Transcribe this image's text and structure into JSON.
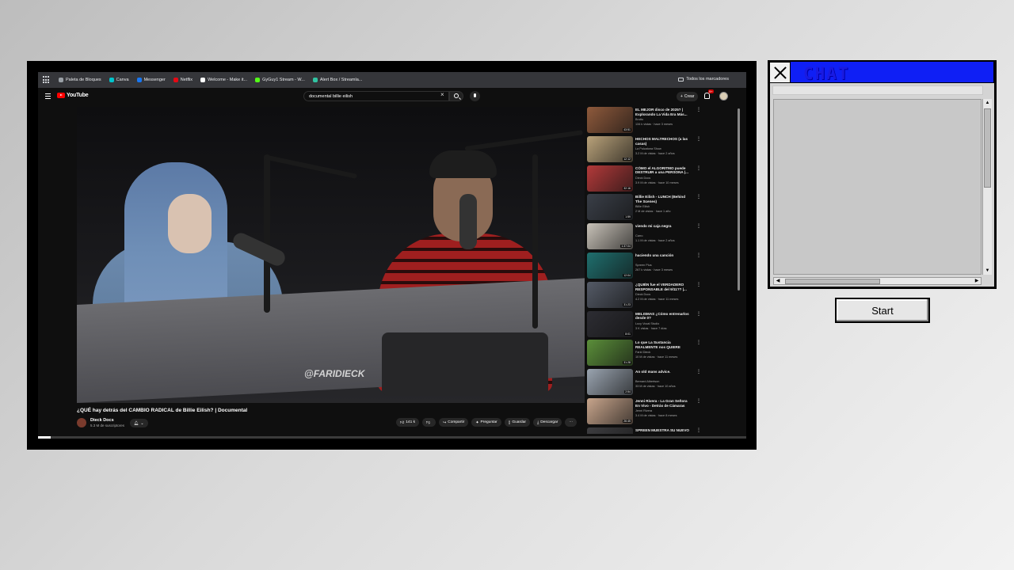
{
  "bookmarks": {
    "items": [
      {
        "label": "Paleta de Bloques",
        "icon": "grid-favicon",
        "color": "#9aa0a6"
      },
      {
        "label": "Canva",
        "icon": "canva-favicon",
        "color": "#00c4cc"
      },
      {
        "label": "Messenger",
        "icon": "messenger-favicon",
        "color": "#1877f2"
      },
      {
        "label": "Netflix",
        "icon": "netflix-favicon",
        "color": "#e50914"
      },
      {
        "label": "Welcome - Make it...",
        "icon": "make-favicon",
        "color": "#ffffff"
      },
      {
        "label": "GyGuy1 Stream - W...",
        "icon": "kick-favicon",
        "color": "#53fc18"
      },
      {
        "label": "Alert Box / Streamla...",
        "icon": "streamlabs-favicon",
        "color": "#31c3a2"
      }
    ],
    "all_label": "Todos los marcadores"
  },
  "youtube": {
    "logo_text": "YouTube",
    "search_value": "documental billie eilish",
    "create_label": "Crear",
    "notifications_count": "9+"
  },
  "video": {
    "watermark": "@FARIDIECK",
    "title": "¿QUÉ hay detrás del CAMBIO RADICAL de Billie Eilish? | Documental",
    "channel": "Dieck Docs",
    "subscribers": "5.3 M de suscriptores",
    "likes": "141 k",
    "actions": {
      "share": "Compartir",
      "ask": "Preguntar",
      "save": "Guardar",
      "download": "Descargar"
    },
    "progress": 0.018
  },
  "recommendations": [
    {
      "title": "EL MEJOR disco de 2025? | Explorando La Vida Era Más...",
      "channel": "Brutto",
      "meta": "134 k vistas · hace 3 meses",
      "duration": "43:51",
      "color": "#8f5a3c"
    },
    {
      "title": "HECHOS MALTRECHOS (a las casas)",
      "channel": "La Pulcatona Show",
      "meta": "3.2 M de vistas · hace 2 años",
      "duration": "12:12",
      "color": "#b9a27a"
    },
    {
      "title": "CÓMO el ALGORITMO puede DESTRUIR a una PERSONA |...",
      "channel": "Dieck Docs",
      "meta": "3.9 M de vistas · hace 10 meses",
      "duration": "32:16",
      "color": "#b33a3a"
    },
    {
      "title": "Billie Eilish - LUNCH (Behind The Scenes)",
      "channel": "Billie Eilish",
      "meta": "2 M de vistas · hace 1 año",
      "duration": "1:59",
      "color": "#3a3f48"
    },
    {
      "title": "viendo mi caja negra",
      "channel": "Carro",
      "meta": "1.1 M de vistas · hace 2 años",
      "duration": "1:37:04",
      "color": "#c8c2b8"
    },
    {
      "title": "haciendo una canción",
      "channel": "Spreen Plus",
      "meta": "267 k vistas · hace 3 meses",
      "duration": "12:04",
      "color": "#1f6f6e"
    },
    {
      "title": "¿QUIÉN fue el VERDADERO RESPONSABLE del 9/11?? |...",
      "channel": "Dieck Docs",
      "meta": "4.2 M de vistas · hace 11 meses",
      "duration": "31:23",
      "color": "#545a66"
    },
    {
      "title": "MELISMAS ¿Cómo entrenarlos desde 0?",
      "channel": "Lucy Vocal Studio",
      "meta": "3 K vistas · hace 7 días",
      "duration": "8:01",
      "color": "#2d2d33"
    },
    {
      "title": "Lo que La Sustancia REALMENTE nos QUIERE DECI...",
      "channel": "Farid Dieck",
      "meta": "10 M de vistas · hace 11 meses",
      "duration": "31:28",
      "color": "#5b8f3a"
    },
    {
      "title": "An old mans advice.",
      "channel": "Bernard Albertson",
      "meta": "33 M de vistas · hace 10 años",
      "duration": "2:54",
      "color": "#9aa4b0"
    },
    {
      "title": "Jenni Rivera - La Gran Señora En Vivo - Detrás de Cámaras",
      "channel": "Jenni Rivera",
      "meta": "3.4 M de vistas · hace 8 meses",
      "duration": "26:45",
      "color": "#c8a58c"
    },
    {
      "title": "SPREEN MUESTRA SU NUEVO",
      "channel": "",
      "meta": "",
      "duration": "",
      "color": "#3d3d40"
    }
  ],
  "chat": {
    "title": "CHAT",
    "start_label": "Start"
  }
}
